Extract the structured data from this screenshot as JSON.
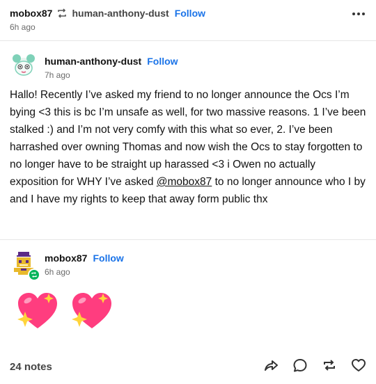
{
  "reblog_header": {
    "username": "mobox87",
    "reblogged_from": "human-anthony-dust",
    "follow_label": "Follow",
    "time": "6h ago"
  },
  "original_post": {
    "username": "human-anthony-dust",
    "follow_label": "Follow",
    "time": "7h ago",
    "text_before_mention": "Hallo! Recently I’ve asked my friend to no longer announce the Ocs I’m bying <3 this is bc I’m unsafe as well, for two massive reasons. 1 I’ve been stalked :) and I’m not very comfy with this what so ever, 2. I’ve been harrashed over owning Thomas and now wish the Ocs to stay forgotten to no longer have to be straight up harassed <3 i Owen no actually exposition for WHY I’ve asked ",
    "mention": "@mobox87",
    "text_after_mention": " to no longer announce who I by and I have my rights to keep that away form public thx"
  },
  "reblog_post": {
    "username": "mobox87",
    "follow_label": "Follow",
    "time": "6h ago",
    "emojis": [
      "sparkling-heart",
      "sparkling-heart"
    ]
  },
  "footer": {
    "notes": "24 notes",
    "actions": [
      "share-icon",
      "reply-icon",
      "reblog-icon",
      "like-icon"
    ]
  },
  "colors": {
    "follow": "#1a73e8",
    "text": "#121212",
    "muted": "#6b6b6b",
    "heart": "#ff3d7f",
    "reblog_badge": "#00b55a"
  }
}
